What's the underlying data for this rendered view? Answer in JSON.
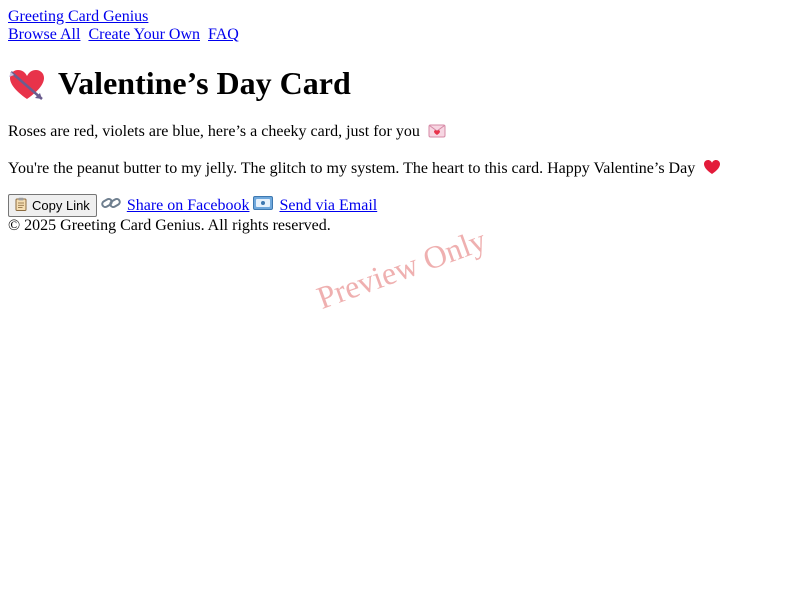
{
  "header": {
    "site_title": "Greeting Card Genius",
    "nav": [
      {
        "label": "Browse All"
      },
      {
        "label": "Create Your Own"
      },
      {
        "label": "FAQ"
      }
    ]
  },
  "card": {
    "title_icon": "heart-with-arrow-icon",
    "title": "Valentine’s Day Card",
    "verse_line_1": "Roses are red, violets are blue, here’s a cheeky card, just for you",
    "verse_line_1_icon": "love-letter-icon",
    "verse_line_2": "You're the peanut butter to my jelly. The glitch to my system. The heart to this card. Happy Valentine’s Day",
    "verse_line_2_icon": "red-heart-icon"
  },
  "actions": {
    "copy_label": "Copy Link",
    "copy_icon": "clipboard-icon",
    "facebook_label": "Share on Facebook",
    "facebook_icon": "link-icon",
    "email_label": "Send via Email",
    "email_icon": "envelope-icon"
  },
  "footer": {
    "copyright": "© 2025 Greeting Card Genius. All rights reserved."
  },
  "watermark": {
    "text": "Preview Only"
  },
  "colors": {
    "link": "#0000ee",
    "watermark": "#dc5050",
    "heart": "#e8334a"
  }
}
